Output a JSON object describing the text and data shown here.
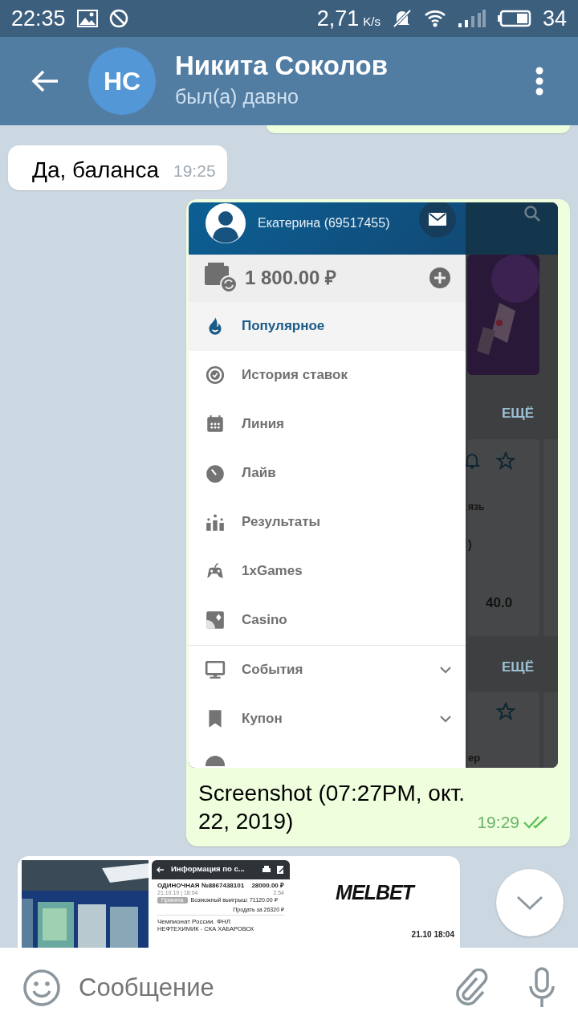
{
  "status_bar": {
    "time": "22:35",
    "speed": "2,71",
    "speed_unit": "K/s",
    "battery": "34"
  },
  "header": {
    "avatar": "НС",
    "title": "Никита Соколов",
    "subtitle": "был(а) давно"
  },
  "messages": [
    {
      "kind": "text",
      "outgoing": false,
      "text": "Да, баланса",
      "time": "19:25"
    },
    {
      "kind": "screenshot",
      "outgoing": true,
      "caption": "Screenshot (07:27PM, окт. 22, 2019)",
      "time": "19:29",
      "read": true,
      "screen": {
        "account": "Екатерина (69517455)",
        "balance": "1 800.00 ₽",
        "menu": [
          {
            "label": "Популярное",
            "selected": true,
            "expandable": false
          },
          {
            "label": "История ставок",
            "selected": false,
            "expandable": false
          },
          {
            "label": "Линия",
            "selected": false,
            "expandable": false
          },
          {
            "label": "Лайв",
            "selected": false,
            "expandable": false
          },
          {
            "label": "Результаты",
            "selected": false,
            "expandable": false
          },
          {
            "label": "1xGames",
            "selected": false,
            "expandable": false
          },
          {
            "label": "Casino",
            "selected": false,
            "expandable": false
          },
          {
            "label": "События",
            "selected": false,
            "expandable": true
          },
          {
            "label": "Купон",
            "selected": false,
            "expandable": true
          }
        ],
        "behind": [
          "ЕЩЁ",
          "язь",
          ")",
          "40.0",
          "ЕЩЁ",
          "ер"
        ]
      }
    },
    {
      "kind": "album",
      "outgoing": false,
      "slip": {
        "title": "Информация по с...",
        "bet": "ОДИНОЧНАЯ №8867438101",
        "amount": "28000.00 ₽",
        "date": "21.10.19 | 18:04",
        "odds": "2.54",
        "status": "Принята",
        "win": "Возможный выигрыш: 71120.00 ₽",
        "sell": "Продать за 26320 ₽",
        "league": "Чемпионат России. ФНЛ",
        "match": "НЕФТЕХИМИК - СКА ХАБАРОВСК"
      },
      "brand": "MELBET",
      "date": "21.10 18:04"
    }
  ],
  "input": {
    "placeholder": "Сообщение"
  }
}
